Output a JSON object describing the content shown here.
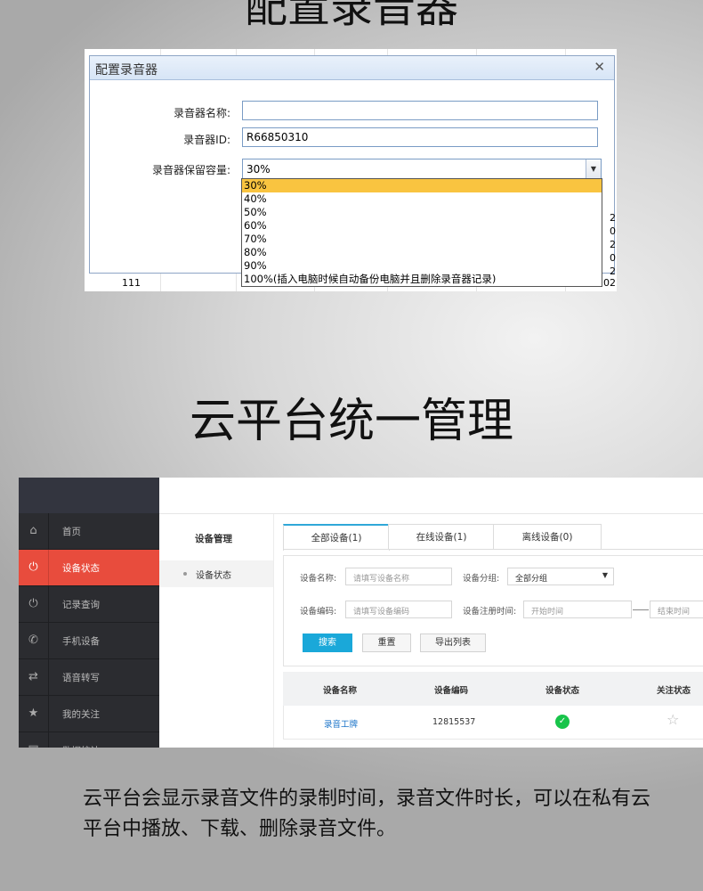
{
  "section1": {
    "title": "配置录音器"
  },
  "dialog": {
    "title": "配置录音器",
    "close_icon": "close-icon",
    "name_label": "录音器名称:",
    "name_value": "",
    "id_label": "录音器ID:",
    "id_value": "R66850310",
    "capacity_label": "录音器保留容量:",
    "capacity_selected": "30%",
    "capacity_options": [
      "30%",
      "40%",
      "50%",
      "60%",
      "70%",
      "80%",
      "90%",
      "100%(插入电脑时候自动备份电脑并且删除录音器记录)"
    ],
    "background_row_label": "111",
    "background_right_digits": [
      "2",
      "0",
      "2",
      "0",
      "2"
    ],
    "background_tail": "202"
  },
  "section2": {
    "title": "云平台统一管理"
  },
  "platform": {
    "sidebar": [
      {
        "label": "首页",
        "icon": "home-icon",
        "glyph": "⌂"
      },
      {
        "label": "设备状态",
        "icon": "power-icon",
        "glyph": "⏻",
        "active": true
      },
      {
        "label": "记录查询",
        "icon": "power-icon",
        "glyph": "⏻"
      },
      {
        "label": "手机设备",
        "icon": "phone-icon",
        "glyph": "✆"
      },
      {
        "label": "语音转写",
        "icon": "transfer-icon",
        "glyph": "⇄"
      },
      {
        "label": "我的关注",
        "icon": "star-icon",
        "glyph": "★"
      },
      {
        "label": "数据统计",
        "icon": "chart-icon",
        "glyph": "▤"
      }
    ],
    "submenu_title": "设备管理",
    "submenu_item": "设备状态",
    "tabs": [
      "全部设备(1)",
      "在线设备(1)",
      "离线设备(0)"
    ],
    "filters": {
      "device_name_label": "设备名称:",
      "device_name_placeholder": "请填写设备名称",
      "group_label": "设备分组:",
      "group_value": "全部分组",
      "device_code_label": "设备编码:",
      "device_code_placeholder": "请填写设备编码",
      "register_time_label": "设备注册时间:",
      "start_placeholder": "开始时间",
      "end_placeholder": "结束时间"
    },
    "buttons": {
      "search": "搜索",
      "reset": "重置",
      "export": "导出列表"
    },
    "table": {
      "headers": [
        "设备名称",
        "设备编码",
        "设备状态",
        "关注状态"
      ],
      "rows": [
        {
          "name": "录音工牌",
          "code": "12815537",
          "status_icon": "check-circle-icon",
          "follow_icon": "star-outline-icon"
        }
      ]
    }
  },
  "description": "云平台会显示录音文件的录制时间，录音文件时长，可以在私有云平台中播放、下载、删除录音文件。"
}
